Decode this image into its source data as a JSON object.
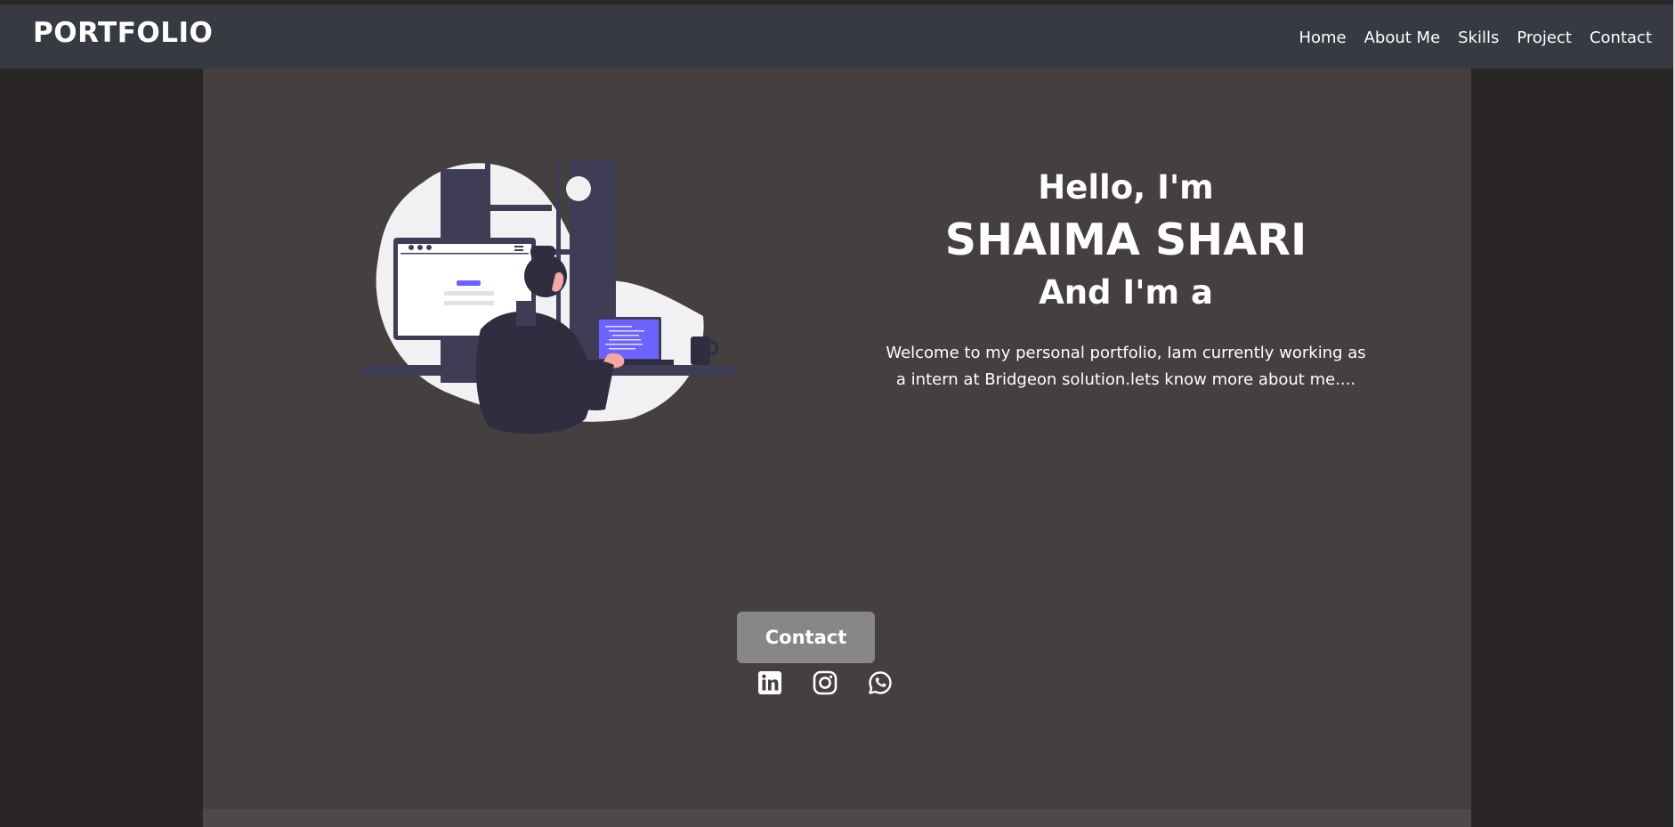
{
  "brand": "PORTFOLIO",
  "nav": {
    "items": [
      {
        "label": "Home"
      },
      {
        "label": "About Me"
      },
      {
        "label": "Skills"
      },
      {
        "label": "Project"
      },
      {
        "label": "Contact"
      }
    ]
  },
  "hero": {
    "greeting": "Hello, I'm",
    "name": "SHAIMA SHARI",
    "role_prefix": "And I'm a",
    "welcome": "Welcome to my personal portfolio, Iam currently working as a intern at Bridgeon solution.lets know more about me...."
  },
  "contact_button": "Contact",
  "socials": [
    {
      "icon": "linkedin-icon"
    },
    {
      "icon": "instagram-icon"
    },
    {
      "icon": "whatsapp-icon"
    }
  ],
  "colors": {
    "navbar": "#373a42",
    "page_side": "#2a2625",
    "main": "#453f3f",
    "button": "#878787",
    "accent": "#6c63ff"
  }
}
